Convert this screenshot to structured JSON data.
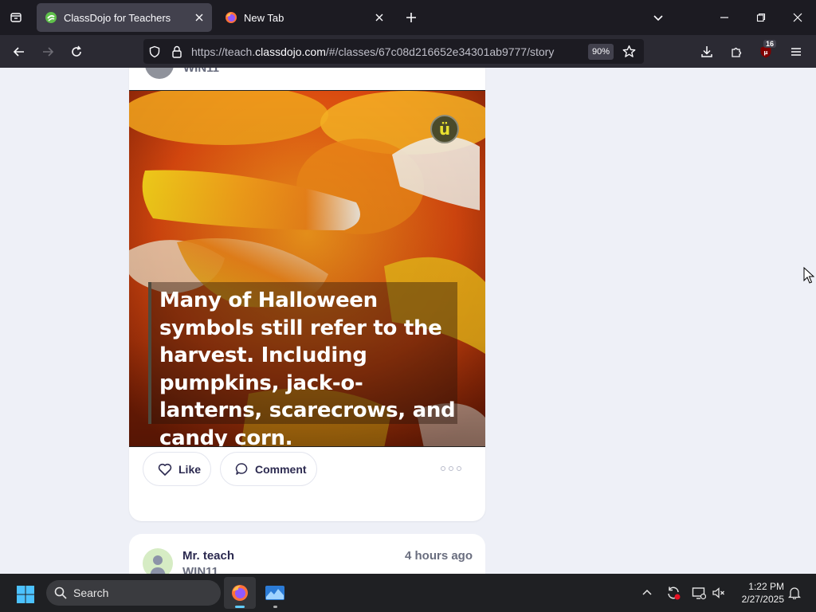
{
  "browser": {
    "tabs": [
      {
        "title": "ClassDojo for Teachers",
        "active": true,
        "favicon": "classdojo-logo-icon"
      },
      {
        "title": "New Tab",
        "active": false,
        "favicon": "firefox-logo-icon"
      }
    ],
    "url": {
      "prefix": "https://teach.",
      "host": "classdojo.com",
      "path": "/#/classes/67c08d216652e34301ab9777/story"
    },
    "zoom": "90%",
    "extension_badge": "16"
  },
  "post1": {
    "class_name_fragment": "WIN11",
    "image_caption": "Many of Halloween symbols still refer to the harvest. Including pumpkins, jack-o-lanterns, scarecrows, and candy corn.",
    "logo_letter": "ü",
    "like_label": "Like",
    "comment_label": "Comment"
  },
  "post2": {
    "teacher_name": "Mr. teach",
    "class_name": "WIN11",
    "timestamp": "4 hours ago"
  },
  "taskbar": {
    "search_label": "Search",
    "time": "1:22 PM",
    "date": "2/27/2025"
  },
  "colors": {
    "accent_text": "#2c2a50",
    "muted_text": "#6a6e7f",
    "page_bg": "#eef0f7",
    "browser_dark": "#1c1b22"
  }
}
